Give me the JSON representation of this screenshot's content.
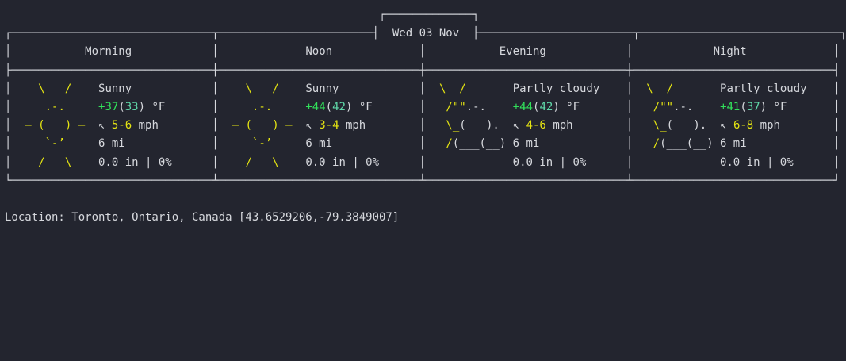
{
  "date": "Wed 03 Nov",
  "periods": [
    "Morning",
    "Noon",
    "Evening",
    "Night"
  ],
  "forecast": [
    {
      "condition": "Sunny",
      "temp": "+37",
      "feels": "33",
      "temp_unit": "°F",
      "wind": "5-6",
      "wind_unit": "mph",
      "visibility": "6 mi",
      "precip": "0.0 in | 0%",
      "icon": "sun-icon"
    },
    {
      "condition": "Sunny",
      "temp": "+44",
      "feels": "42",
      "temp_unit": "°F",
      "wind": "3-4",
      "wind_unit": "mph",
      "visibility": "6 mi",
      "precip": "0.0 in | 0%",
      "icon": "sun-icon"
    },
    {
      "condition": "Partly cloudy",
      "temp": "+44",
      "feels": "42",
      "temp_unit": "°F",
      "wind": "4-6",
      "wind_unit": "mph",
      "visibility": "6 mi",
      "precip": "0.0 in | 0%",
      "icon": "partly-cloudy-icon"
    },
    {
      "condition": "Partly cloudy",
      "temp": "+41",
      "feels": "37",
      "temp_unit": "°F",
      "wind": "6-8",
      "wind_unit": "mph",
      "visibility": "6 mi",
      "precip": "0.0 in | 0%",
      "icon": "partly-cloudy-icon"
    }
  ],
  "location": "Location: Toronto, Ontario, Canada [43.6529206,-79.3849007]",
  "colors": {
    "background": "#23252f",
    "text": "#d6d8dd",
    "sun": "#e5e512",
    "temp_warm": "#31e05a",
    "temp_feels": "#5fd7a8",
    "wind_value": "#e5e512"
  }
}
